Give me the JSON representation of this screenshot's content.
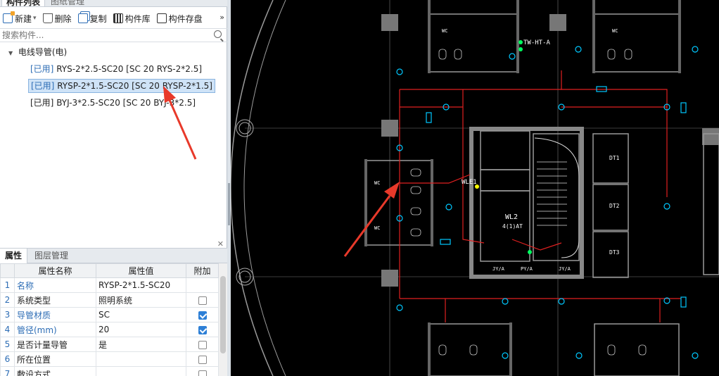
{
  "tabs": {
    "component_list": "构件列表",
    "drawing_manage": "图纸管理"
  },
  "toolbar": {
    "new_label": "新建",
    "delete_label": "删除",
    "copy_label": "复制",
    "library_label": "构件库",
    "store_label": "构件存盘",
    "more_label": "»"
  },
  "search": {
    "placeholder": "搜索构件..."
  },
  "tree": {
    "root_label": "电线导管(电)",
    "items": [
      {
        "tag": "[已用]",
        "label": "RYS-2*2.5-SC20 [SC 20 RYS-2*2.5]"
      },
      {
        "tag": "[已用]",
        "label": "RYSP-2*1.5-SC20 [SC 20 RYSP-2*1.5]"
      },
      {
        "tag": "[已用]",
        "label": "BYJ-3*2.5-SC20 [SC 20 BYJ-3*2.5]"
      }
    ]
  },
  "properties": {
    "tabs": {
      "props": "属性",
      "layers": "图层管理"
    },
    "headers": {
      "index": "",
      "name": "属性名称",
      "value": "属性值",
      "extra": "附加"
    },
    "rows": [
      {
        "index": "1",
        "name": "名称",
        "value": "RYSP-2*1.5-SC20",
        "checkbox": "none"
      },
      {
        "index": "2",
        "name": "系统类型",
        "value": "照明系统",
        "checkbox": "off"
      },
      {
        "index": "3",
        "name": "导管材质",
        "value": "SC",
        "checkbox": "on"
      },
      {
        "index": "4",
        "name": "管径(mm)",
        "value": "20",
        "checkbox": "on"
      },
      {
        "index": "5",
        "name": "是否计量导管",
        "value": "是",
        "checkbox": "off"
      },
      {
        "index": "6",
        "name": "所在位置",
        "value": "",
        "checkbox": "off"
      },
      {
        "index": "7",
        "name": "敷设方式",
        "value": "",
        "checkbox": "off"
      }
    ]
  },
  "cad": {
    "labels": {
      "tw": "TW-HT-A",
      "wl1": "WLE1",
      "wl2": "WL2",
      "wl2b": "4(1)AT",
      "dt1": "DT1",
      "dt2": "DT2",
      "dt3": "DT3",
      "wc": "WC",
      "jya": "JY/A",
      "py": "PY/A"
    }
  },
  "colors": {
    "accent": "#2d6db5",
    "selected_bg": "#cfe3f7",
    "cad_bg": "#000000",
    "wire": "#e02020",
    "device": "#00c8ff",
    "arrow": "#e8392a"
  }
}
